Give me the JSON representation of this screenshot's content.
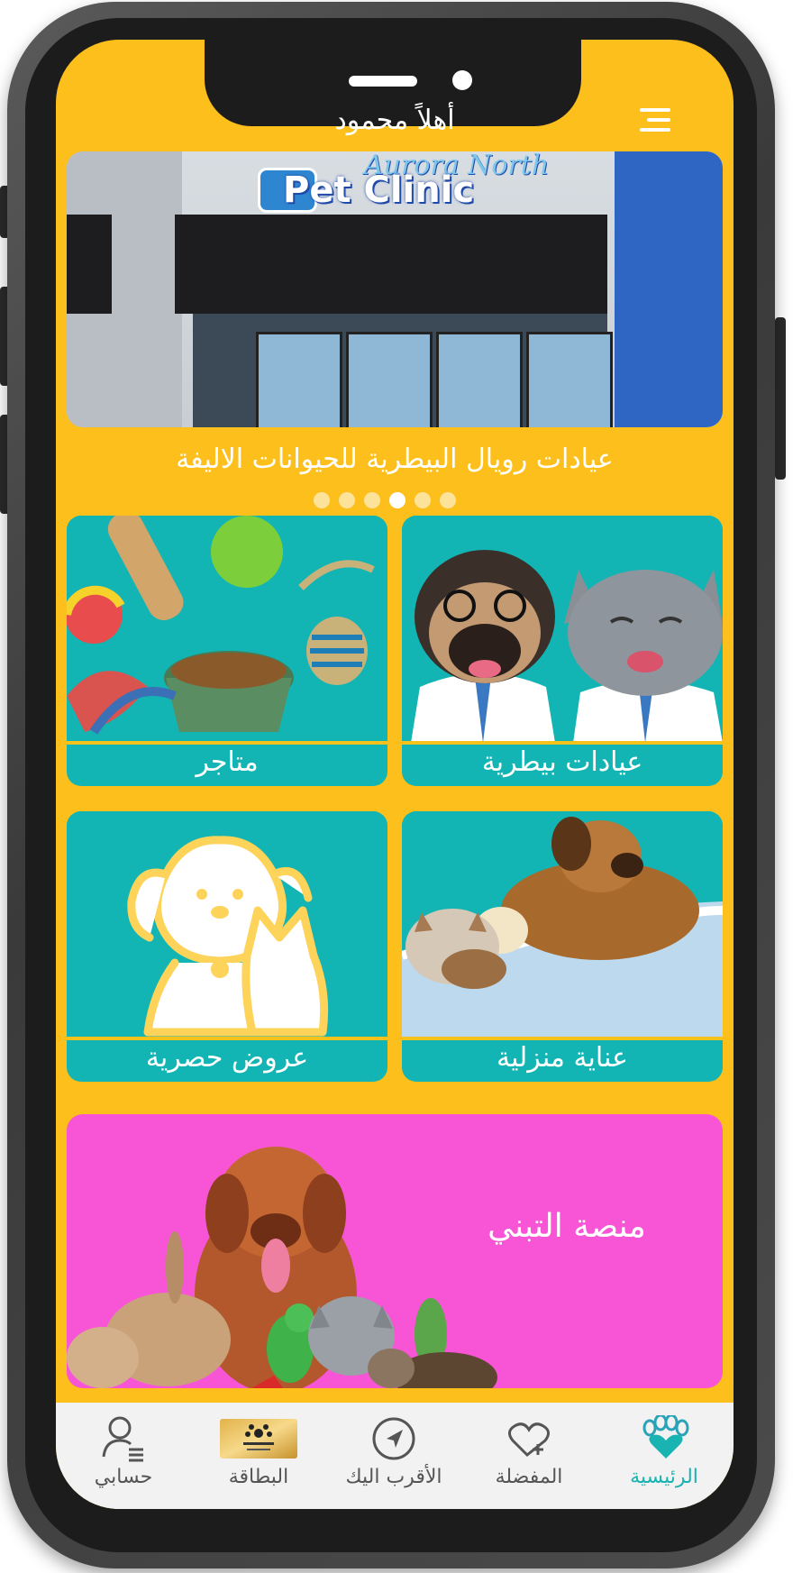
{
  "header": {
    "greeting": "أهلاً محمود",
    "menu_icon": "hamburger-menu-icon"
  },
  "carousel": {
    "image_sign_text": "Pet Clinic",
    "image_sign_subtext": "Aurora North",
    "caption": "عيادات رويال البيطرية للحيوانات الاليفة",
    "total_slides": 6,
    "active_slide": 4
  },
  "tiles": [
    {
      "id": "vet-clinics",
      "label": "عيادات بيطرية"
    },
    {
      "id": "stores",
      "label": "متاجر"
    },
    {
      "id": "home-care",
      "label": "عناية منزلية"
    },
    {
      "id": "exclusive-offers",
      "label": "عروض حصرية"
    }
  ],
  "adoption_banner": {
    "label": "منصة التبني"
  },
  "tabbar": {
    "items": [
      {
        "id": "home",
        "label": "الرئيسية",
        "icon": "paw-heart-icon",
        "active": true
      },
      {
        "id": "favorites",
        "label": "المفضلة",
        "icon": "heart-plus-icon",
        "active": false
      },
      {
        "id": "nearest",
        "label": "الأقرب اليك",
        "icon": "navigation-arrow-icon",
        "active": false
      },
      {
        "id": "card",
        "label": "البطاقة",
        "icon": "membership-card-icon",
        "active": false
      },
      {
        "id": "account",
        "label": "حسابي",
        "icon": "user-list-icon",
        "active": false
      }
    ]
  },
  "colors": {
    "primary_yellow": "#FDBF1B",
    "tile_teal": "#12B5B3",
    "adoption_pink": "#F755D6",
    "active_tab": "#19B3B1"
  }
}
